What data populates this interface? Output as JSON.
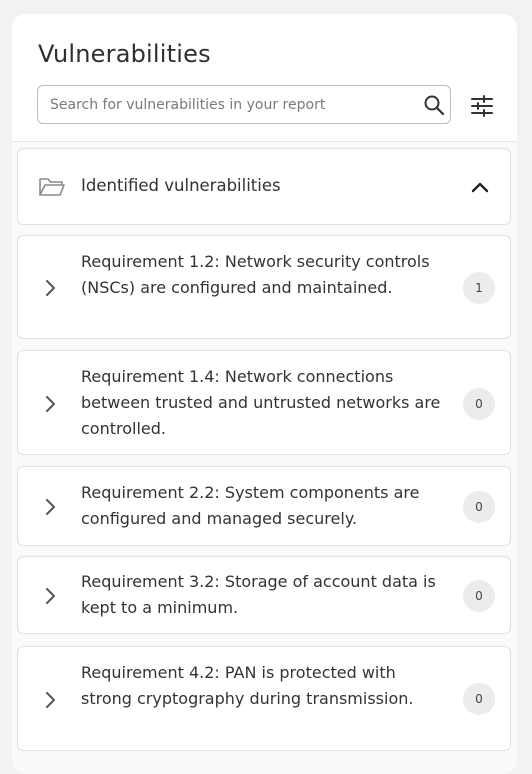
{
  "title": "Vulnerabilities",
  "search": {
    "placeholder": "Search for vulnerabilities in your report",
    "value": ""
  },
  "section": {
    "label": "Identified vulnerabilities",
    "expanded": true
  },
  "requirements": [
    {
      "label": "Requirement 1.2: Network security controls (NSCs) are configured and maintained.",
      "count": "1"
    },
    {
      "label": "Requirement 1.4: Network connections between trusted and untrusted networks are controlled.",
      "count": "0"
    },
    {
      "label": "Requirement 2.2: System components are configured and managed securely.",
      "count": "0"
    },
    {
      "label": "Requirement 3.2: Storage of account data is kept to a minimum.",
      "count": "0"
    },
    {
      "label": "Requirement 4.2: PAN is protected with strong cryptography during transmission.",
      "count": "0"
    }
  ],
  "icons": {
    "search": "search-icon",
    "filter": "sliders-icon",
    "folder": "folder-open-icon",
    "collapse": "chevron-up-icon",
    "expand": "chevron-right-icon"
  },
  "colors": {
    "background": "#f2f2f2",
    "card": "#ffffff",
    "border": "#e1e1e1",
    "badge": "#ececec",
    "text": "#333333"
  }
}
